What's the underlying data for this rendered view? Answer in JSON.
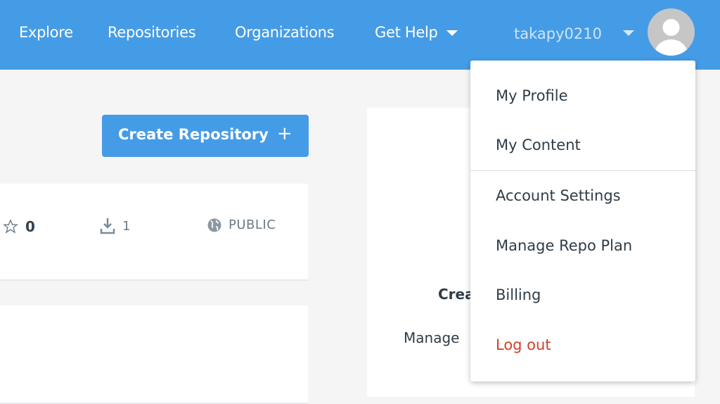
{
  "nav": {
    "items": [
      "Explore",
      "Repositories",
      "Organizations",
      "Get Help"
    ],
    "username": "takapy0210",
    "brand_color": "#459ce6"
  },
  "main": {
    "create_button": "Create Repository",
    "create_icon": "plus-icon",
    "repo_card": {
      "stars": "0",
      "downloads": "1",
      "visibility": "PUBLIC"
    }
  },
  "panel": {
    "title_partial": "Crea",
    "text_partial": "Manage"
  },
  "dropdown": {
    "items": [
      "My Profile",
      "My Content",
      "Account Settings",
      "Manage Repo Plan",
      "Billing",
      "Log out"
    ],
    "logout_color": "#d0402a"
  }
}
